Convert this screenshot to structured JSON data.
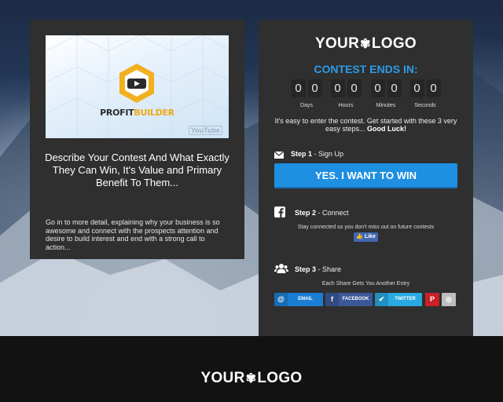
{
  "video": {
    "brand_part1": "PROFIT",
    "brand_part2": "BUILDER",
    "watermark": "YouTube"
  },
  "left": {
    "heading": "Describe Your Contest And What Exactly They Can Win, It's Value and Primary Benefit To Them...",
    "body": "Go in to more detail, explaining why your business is so awesome and connect with the prospects attention and desire to build interest and end with a strong call to action..."
  },
  "logo": {
    "part1": "YOUR",
    "part2": "LOGO"
  },
  "contest": {
    "ends_label": "CONTEST ENDS IN:",
    "countdown": [
      {
        "digits": [
          "0",
          "0"
        ],
        "label": "Days"
      },
      {
        "digits": [
          "0",
          "0"
        ],
        "label": "Hours"
      },
      {
        "digits": [
          "0",
          "0"
        ],
        "label": "Minutes"
      },
      {
        "digits": [
          "0",
          "0"
        ],
        "label": "Seconds"
      }
    ],
    "intro": "It's easy to enter the contest. Get started with these 3 very easy steps...",
    "intro_bold": "Good Luck!"
  },
  "steps": {
    "step1_bold": "Step 1",
    "step1_text": " - Sign Up",
    "win_button": "YES. I WANT TO WIN",
    "step2_bold": "Step 2",
    "step2_text": " - Connect",
    "connect_note": "Stay connected so you don't miss out on future contests",
    "like_label": "Like",
    "step3_bold": "Step 3",
    "step3_text": " - Share",
    "share_note": "Each Share Gets You Another Entry"
  },
  "share": {
    "email": "EMAIL",
    "facebook": "FACEBOOK",
    "twitter": "TWITTER"
  },
  "colors": {
    "accent_blue": "#2b9ce6",
    "button_blue": "#1e8fe1",
    "email_blue": "#1a7fd4",
    "facebook_blue": "#3b5998",
    "twitter_blue": "#29a9e1",
    "pinterest_red": "#cb2027",
    "instagram_gray": "#bdbdbd",
    "brand_orange": "#f0a818"
  }
}
